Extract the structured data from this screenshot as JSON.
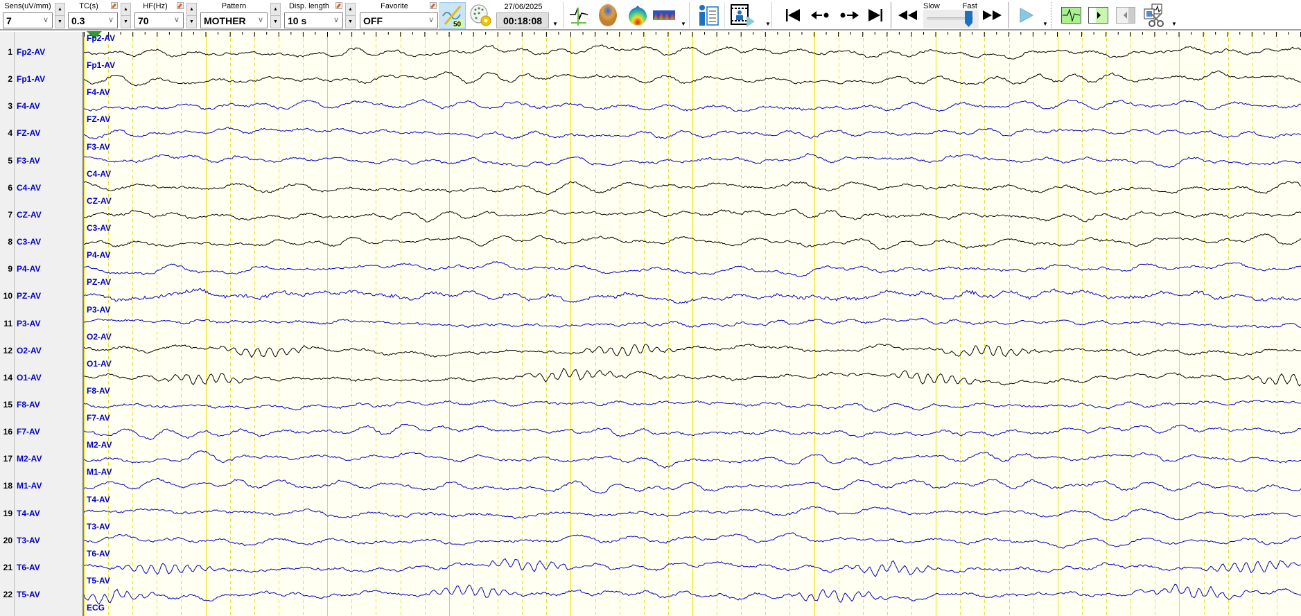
{
  "toolbar": {
    "sens": {
      "label": "Sens(uV/mm)",
      "value": "7"
    },
    "tc": {
      "label": "TC(s)",
      "value": "0.3"
    },
    "hf": {
      "label": "HF(Hz)",
      "value": "70"
    },
    "pattern": {
      "label": "Pattern",
      "value": "MOTHER"
    },
    "disp_length": {
      "label": "Disp. length",
      "value": "10 s"
    },
    "favorite": {
      "label": "Favorite",
      "value": "OFF"
    },
    "notch_badge": "50",
    "date": "27/06/2025",
    "time": "00:18:08",
    "speed": {
      "slow_label": "Slow",
      "fast_label": "Fast",
      "value": 1.0
    }
  },
  "channels": [
    {
      "num": "1",
      "name": "Fp2-AV",
      "color": "#000000"
    },
    {
      "num": "2",
      "name": "Fp1-AV",
      "color": "#000000"
    },
    {
      "num": "3",
      "name": "F4-AV",
      "color": "#0000c8"
    },
    {
      "num": "4",
      "name": "FZ-AV",
      "color": "#0000c8"
    },
    {
      "num": "5",
      "name": "F3-AV",
      "color": "#0000c8"
    },
    {
      "num": "6",
      "name": "C4-AV",
      "color": "#000000"
    },
    {
      "num": "7",
      "name": "CZ-AV",
      "color": "#000000"
    },
    {
      "num": "8",
      "name": "C3-AV",
      "color": "#000000"
    },
    {
      "num": "9",
      "name": "P4-AV",
      "color": "#0000c8"
    },
    {
      "num": "10",
      "name": "PZ-AV",
      "color": "#0000c8"
    },
    {
      "num": "11",
      "name": "P3-AV",
      "color": "#0000c8"
    },
    {
      "num": "12",
      "name": "O2-AV",
      "color": "#000000"
    },
    {
      "num": "14",
      "name": "O1-AV",
      "color": "#000000"
    },
    {
      "num": "15",
      "name": "F8-AV",
      "color": "#0000c8"
    },
    {
      "num": "16",
      "name": "F7-AV",
      "color": "#0000c8"
    },
    {
      "num": "17",
      "name": "M2-AV",
      "color": "#0000c8"
    },
    {
      "num": "18",
      "name": "M1-AV",
      "color": "#0000c8"
    },
    {
      "num": "19",
      "name": "T4-AV",
      "color": "#0000c8"
    },
    {
      "num": "20",
      "name": "T3-AV",
      "color": "#0000c8"
    },
    {
      "num": "21",
      "name": "T6-AV",
      "color": "#0000c8"
    },
    {
      "num": "22",
      "name": "T5-AV",
      "color": "#0000c8"
    }
  ],
  "extra_channel": "ECG",
  "grid": {
    "seconds": 10,
    "minor_per_second": 5,
    "major_color": "#f0e000",
    "minor_color": "#e8e040"
  }
}
